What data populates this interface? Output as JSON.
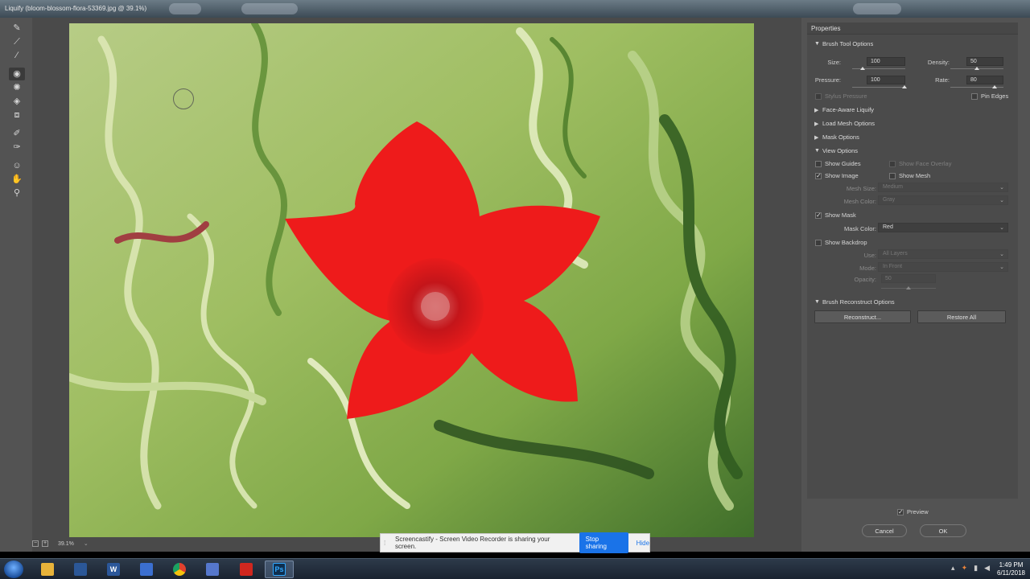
{
  "window": {
    "title": "Liquify (bloom-blossom-flora-53369.jpg @ 39.1%)"
  },
  "toolbar": {
    "tools": [
      {
        "name": "forward-warp-tool-icon",
        "glyph": "✎"
      },
      {
        "name": "reconstruct-tool-icon",
        "glyph": "⟋"
      },
      {
        "name": "smooth-tool-icon",
        "glyph": "∕"
      },
      {
        "name": "twirl-clockwise-tool-icon",
        "glyph": "◉",
        "active": true
      },
      {
        "name": "pucker-tool-icon",
        "glyph": "✺"
      },
      {
        "name": "bloat-tool-icon",
        "glyph": "◈"
      },
      {
        "name": "push-left-tool-icon",
        "glyph": "⧈"
      },
      {
        "name": "freeze-mask-tool-icon",
        "glyph": "✐"
      },
      {
        "name": "thaw-mask-tool-icon",
        "glyph": "✑"
      },
      {
        "name": "face-tool-icon",
        "glyph": "☺"
      },
      {
        "name": "hand-tool-icon",
        "glyph": "✋"
      },
      {
        "name": "zoom-tool-icon",
        "glyph": "⚲"
      }
    ]
  },
  "canvas": {
    "zoom": "39.1%"
  },
  "properties": {
    "header": "Properties",
    "brush_tool_options": {
      "label": "Brush Tool Options",
      "size_label": "Size:",
      "size_value": "100",
      "density_label": "Density:",
      "density_value": "50",
      "pressure_label": "Pressure:",
      "pressure_value": "100",
      "rate_label": "Rate:",
      "rate_value": "80",
      "stylus_pressure": "Stylus Pressure",
      "pin_edges": "Pin Edges"
    },
    "face_aware_liquify": "Face-Aware Liquify",
    "load_mesh_options": "Load Mesh Options",
    "mask_options": "Mask Options",
    "view_options": {
      "label": "View Options",
      "show_guides": "Show Guides",
      "show_face_overlay": "Show Face Overlay",
      "show_image": "Show Image",
      "show_mesh": "Show Mesh",
      "mesh_size_label": "Mesh Size:",
      "mesh_size_value": "Medium",
      "mesh_color_label": "Mesh Color:",
      "mesh_color_value": "Gray",
      "show_mask": "Show Mask",
      "mask_color_label": "Mask Color:",
      "mask_color_value": "Red",
      "show_backdrop": "Show Backdrop",
      "use_label": "Use:",
      "use_value": "All Layers",
      "mode_label": "Mode:",
      "mode_value": "In Front",
      "opacity_label": "Opacity:",
      "opacity_value": "50"
    },
    "brush_reconstruct_options": {
      "label": "Brush Reconstruct Options",
      "reconstruct": "Reconstruct...",
      "restore_all": "Restore All"
    }
  },
  "footer": {
    "preview": "Preview",
    "cancel": "Cancel",
    "ok": "OK"
  },
  "screenshare": {
    "message": "Screencastify - Screen Video Recorder is sharing your screen.",
    "stop": "Stop sharing",
    "hide": "Hide"
  },
  "taskbar": {
    "time": "1:49 PM",
    "date": "6/11/2018",
    "apps": [
      {
        "name": "file-explorer-icon",
        "label": "",
        "color": "#e8b33a"
      },
      {
        "name": "app-icon",
        "label": "",
        "color": "#2b5797"
      },
      {
        "name": "word-icon",
        "label": "W",
        "color": "#2b579a"
      },
      {
        "name": "g-app-icon",
        "label": "",
        "color": "#3b6fd0"
      },
      {
        "name": "chrome-icon",
        "label": "",
        "color": "#e1412d"
      },
      {
        "name": "app-icon-2",
        "label": "",
        "color": "#5577cc"
      },
      {
        "name": "creative-cloud-icon",
        "label": "",
        "color": "#d0271f"
      },
      {
        "name": "photoshop-icon",
        "label": "Ps",
        "color": "#0f2f4f"
      }
    ]
  },
  "colors": {
    "accent": "#1a73e8",
    "panel": "#4b4b4b",
    "mask": "#ff1a1a"
  }
}
